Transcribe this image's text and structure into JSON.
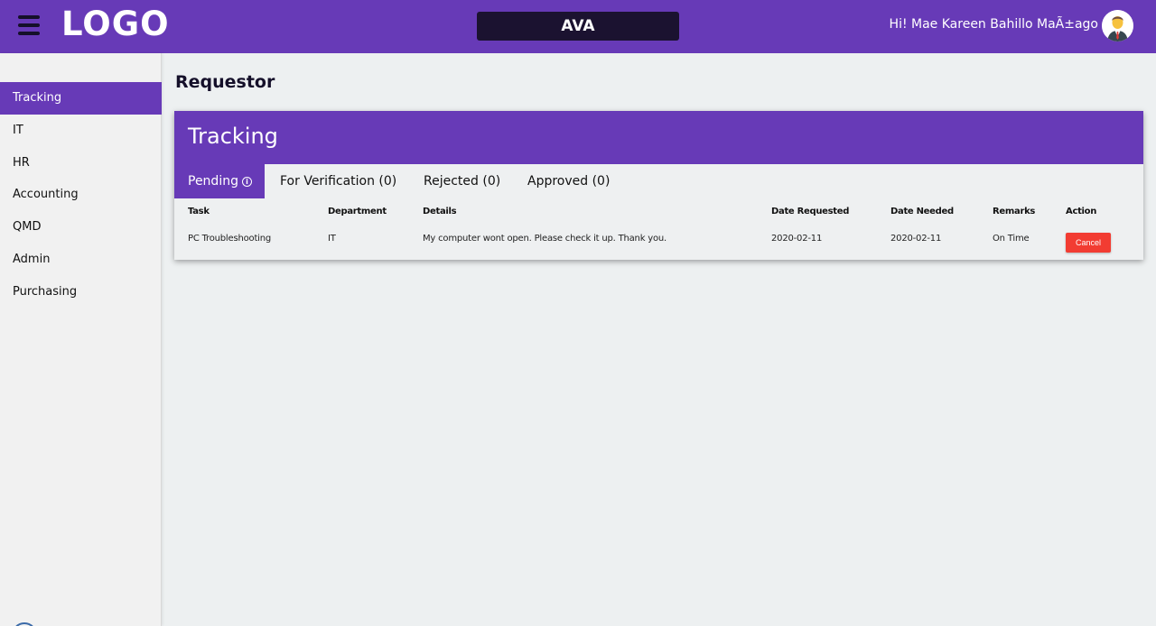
{
  "header": {
    "logo": "LOGO",
    "app_name": "AVA",
    "greeting": "Hi! Mae Kareen Bahillo MaÃ±ago"
  },
  "sidebar": {
    "items": [
      {
        "label": "Tracking",
        "active": true
      },
      {
        "label": "IT"
      },
      {
        "label": "HR"
      },
      {
        "label": "Accounting"
      },
      {
        "label": "QMD"
      },
      {
        "label": "Admin"
      },
      {
        "label": "Purchasing"
      }
    ]
  },
  "main": {
    "page_title": "Requestor",
    "card_title": "Tracking",
    "tabs": [
      {
        "label": "Pending",
        "active": true,
        "icon": "info-icon"
      },
      {
        "label": "For Verification (0)"
      },
      {
        "label": "Rejected (0)"
      },
      {
        "label": "Approved (0)"
      }
    ],
    "table": {
      "columns": [
        "Task",
        "Department",
        "Details",
        "Date Requested",
        "Date Needed",
        "Remarks",
        "Action"
      ],
      "rows": [
        {
          "task": "PC Troubleshooting",
          "department": "IT",
          "details": "My computer wont open. Please check it up. Thank you.",
          "date_requested": "2020-02-11",
          "date_needed": "2020-02-11",
          "remarks": "On Time",
          "action_label": "Cancel"
        }
      ]
    }
  },
  "colors": {
    "primary": "#673ab7",
    "topbar_dark": "#1b1230",
    "cancel": "#f23c32",
    "background": "#edf0f1"
  }
}
